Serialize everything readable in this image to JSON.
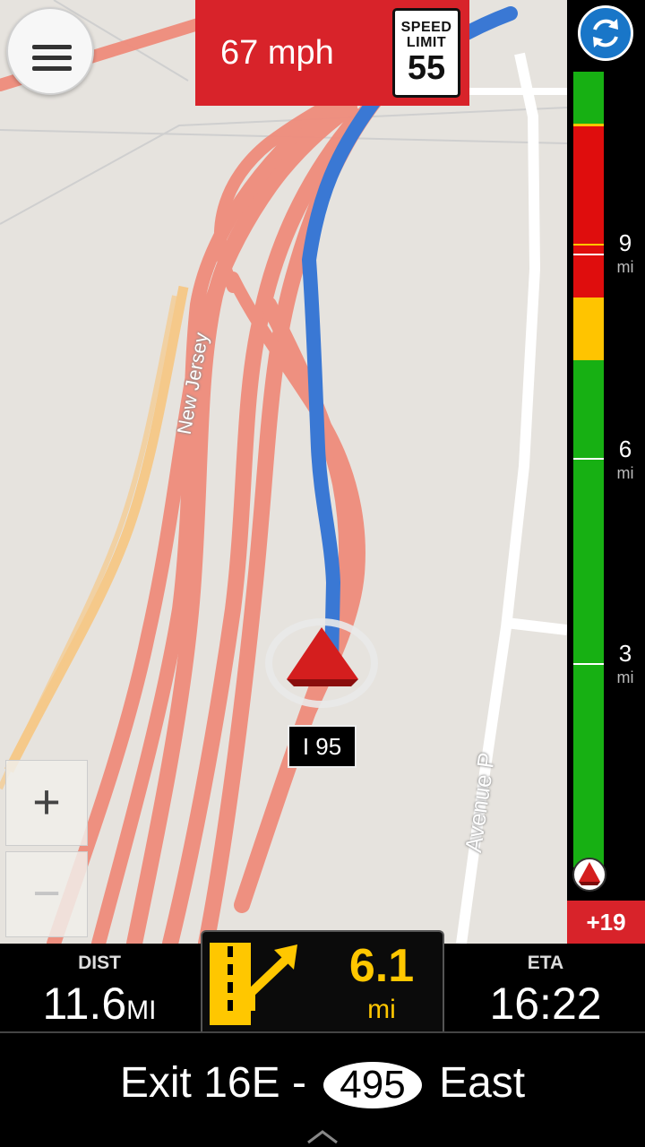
{
  "header": {
    "current_speed": "67 mph",
    "speed_limit_title": "SPEED LIMIT",
    "speed_limit_value": "55"
  },
  "map": {
    "road_labels": {
      "new_jersey": "New Jersey",
      "avenue_p": "Avenue P"
    },
    "route_shield": "I 95",
    "zoom_in_label": "+",
    "zoom_out_label": "−",
    "colors": {
      "background": "#e6e3de",
      "heavy_traffic_road": "#ef8c7c",
      "route": "#3a78d4",
      "minor_road_orange": "#f5c98a"
    }
  },
  "sidebar": {
    "refresh_icon": "refresh-icon",
    "mile_markers": [
      {
        "num": "9",
        "unit": "mi"
      },
      {
        "num": "6",
        "unit": "mi"
      },
      {
        "num": "3",
        "unit": "mi"
      }
    ],
    "traffic_colors": {
      "green": "#17b013",
      "red": "#df0d0d",
      "yellow": "#ffc400"
    },
    "delay": "+19"
  },
  "bottom": {
    "dist_label": "DIST",
    "dist_value": "11.6",
    "dist_unit": "MI",
    "eta_label": "ETA",
    "eta_value": "16:22",
    "turn_distance": "6.1",
    "turn_unit": "mi",
    "turn_icon": "exit-right-icon"
  },
  "instruction": {
    "prefix": "Exit 16E -",
    "route_shield": "495",
    "suffix": "East"
  }
}
